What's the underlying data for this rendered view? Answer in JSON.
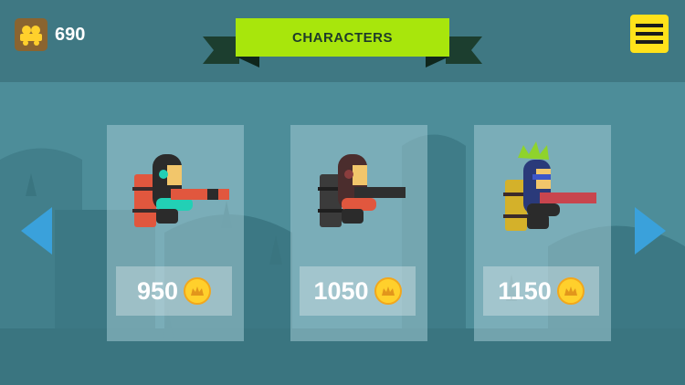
{
  "title": "CHARACTERS",
  "wallet": {
    "amount": "690",
    "icon": "coin-cart-icon"
  },
  "menu": {
    "icon": "menu-icon"
  },
  "navigation": {
    "prev_icon": "arrow-left-icon",
    "next_icon": "arrow-right-icon"
  },
  "characters": [
    {
      "price": "950",
      "coin_icon": "crown-coin-icon",
      "pack_color": "#e1573e",
      "hair": "black"
    },
    {
      "price": "1050",
      "coin_icon": "crown-coin-icon",
      "pack_color": "#3b3b3b",
      "hair": "dark"
    },
    {
      "price": "1150",
      "coin_icon": "crown-coin-icon",
      "pack_color": "#d4b12a",
      "hair": "green-spiky"
    }
  ],
  "colors": {
    "title_banner": "#a8e60c",
    "menu_button": "#ffe21a",
    "nav_arrow": "#3aa1db",
    "coin": "#ffd02c",
    "background": "#4a8a96"
  }
}
